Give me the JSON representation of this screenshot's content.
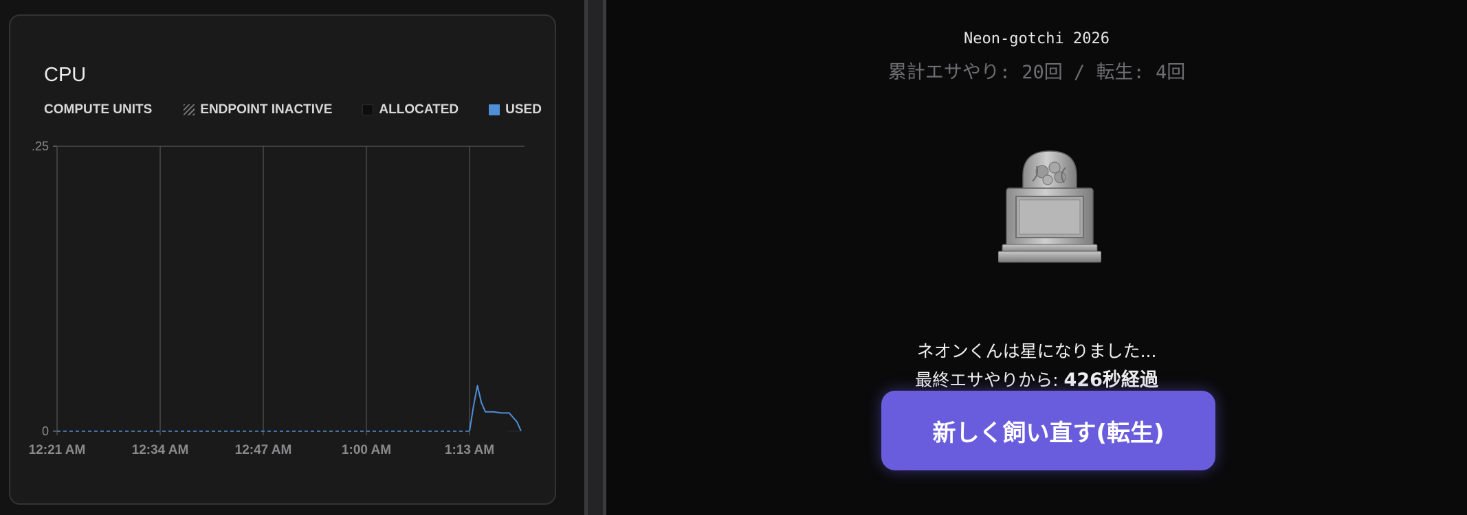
{
  "cpu_card": {
    "title": "CPU",
    "legend": {
      "compute_units": "COMPUTE UNITS",
      "endpoint_inactive": "ENDPOINT INACTIVE",
      "allocated": "ALLOCATED",
      "used": "USED"
    }
  },
  "chart_data": {
    "type": "line",
    "title": "CPU",
    "ylabel": "",
    "xlabel": "",
    "ylim": [
      0,
      0.25
    ],
    "y_ticks": [
      ".25",
      "0"
    ],
    "x_ticks": [
      "12:21 AM",
      "12:34 AM",
      "12:47 AM",
      "1:00 AM",
      "1:13 AM"
    ],
    "series": [
      {
        "name": "USED",
        "color": "#4f8fd8",
        "points": [
          {
            "x": "12:21 AM",
            "y": 0
          },
          {
            "x": "1:13 AM",
            "y": 0
          },
          {
            "x": "1:13:30 AM",
            "y": 0.022
          },
          {
            "x": "1:14 AM",
            "y": 0.04
          },
          {
            "x": "1:14:30 AM",
            "y": 0.025
          },
          {
            "x": "1:15 AM",
            "y": 0.017
          },
          {
            "x": "1:16 AM",
            "y": 0.017
          },
          {
            "x": "1:17 AM",
            "y": 0.016
          },
          {
            "x": "1:18 AM",
            "y": 0.016
          },
          {
            "x": "1:19 AM",
            "y": 0.008
          },
          {
            "x": "1:19:30 AM",
            "y": 0
          }
        ]
      }
    ]
  },
  "game": {
    "title": "Neon-gotchi 2026",
    "stats": "累計エサやり: 20回 / 転生: 4回",
    "death_message": "ネオンくんは星になりました...",
    "elapsed_prefix": "最終エサやりから: ",
    "elapsed_value": "426秒経過",
    "rebirth_button": "新しく飼い直す(転生)",
    "tombstone_icon": "tombstone-icon"
  }
}
